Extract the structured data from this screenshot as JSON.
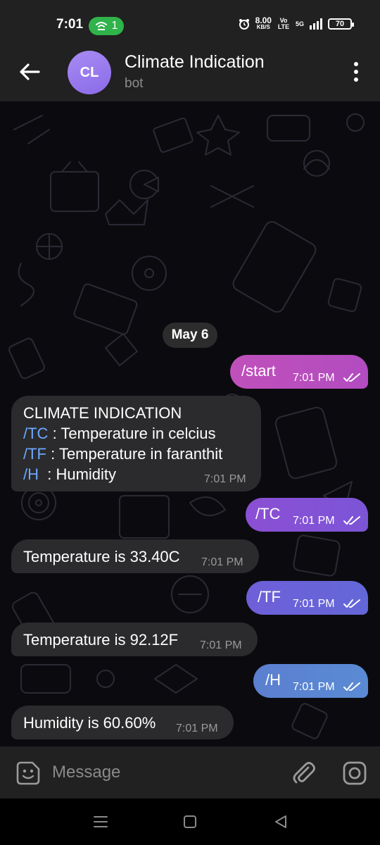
{
  "status_bar": {
    "time": "7:01",
    "hotspot_count": "1",
    "speed_value": "8.00",
    "speed_unit": "KB/S",
    "volte": "Vo LTE",
    "network": "5G",
    "battery": "70"
  },
  "header": {
    "avatar_initials": "CL",
    "title": "Climate Indication",
    "subtitle": "bot"
  },
  "chat": {
    "date_label": "May 6",
    "messages": [
      {
        "direction": "out",
        "text": "/start",
        "time": "7:01 PM"
      },
      {
        "direction": "in",
        "lines": [
          {
            "text": "CLIMATE INDICATION"
          },
          {
            "cmd": "/TC",
            "desc": " : Temperature in celcius"
          },
          {
            "cmd": "/TF",
            "desc": " : Temperature in faranthit"
          },
          {
            "cmd": "/H",
            "desc": "  : Humidity"
          }
        ],
        "time": "7:01 PM"
      },
      {
        "direction": "out",
        "text": "/TC",
        "time": "7:01 PM"
      },
      {
        "direction": "in",
        "text": "Temperature is 33.40C",
        "time": "7:01 PM"
      },
      {
        "direction": "out",
        "text": "/TF",
        "time": "7:01 PM"
      },
      {
        "direction": "in",
        "text": "Temperature is 92.12F",
        "time": "7:01 PM"
      },
      {
        "direction": "out",
        "text": "/H",
        "time": "7:01 PM"
      },
      {
        "direction": "in",
        "text": "Humidity is 60.60%",
        "time": "7:01 PM"
      }
    ]
  },
  "composer": {
    "placeholder": "Message"
  },
  "icons": {
    "back": "arrow-left-icon",
    "more": "more-vertical-icon",
    "emoji": "sticker-emoji-icon",
    "attach": "paperclip-icon",
    "camera": "camera-icon",
    "read": "double-check-icon"
  },
  "colors": {
    "header_bg": "#212121",
    "chat_bg": "#0b0b0f",
    "incoming_bubble": "#2b2b2d",
    "outgoing_gradient_top": "#c050bb",
    "outgoing_gradient_bottom": "#5a8bd3",
    "command_link": "#6ea8ff",
    "avatar": "#9a7cf0"
  }
}
